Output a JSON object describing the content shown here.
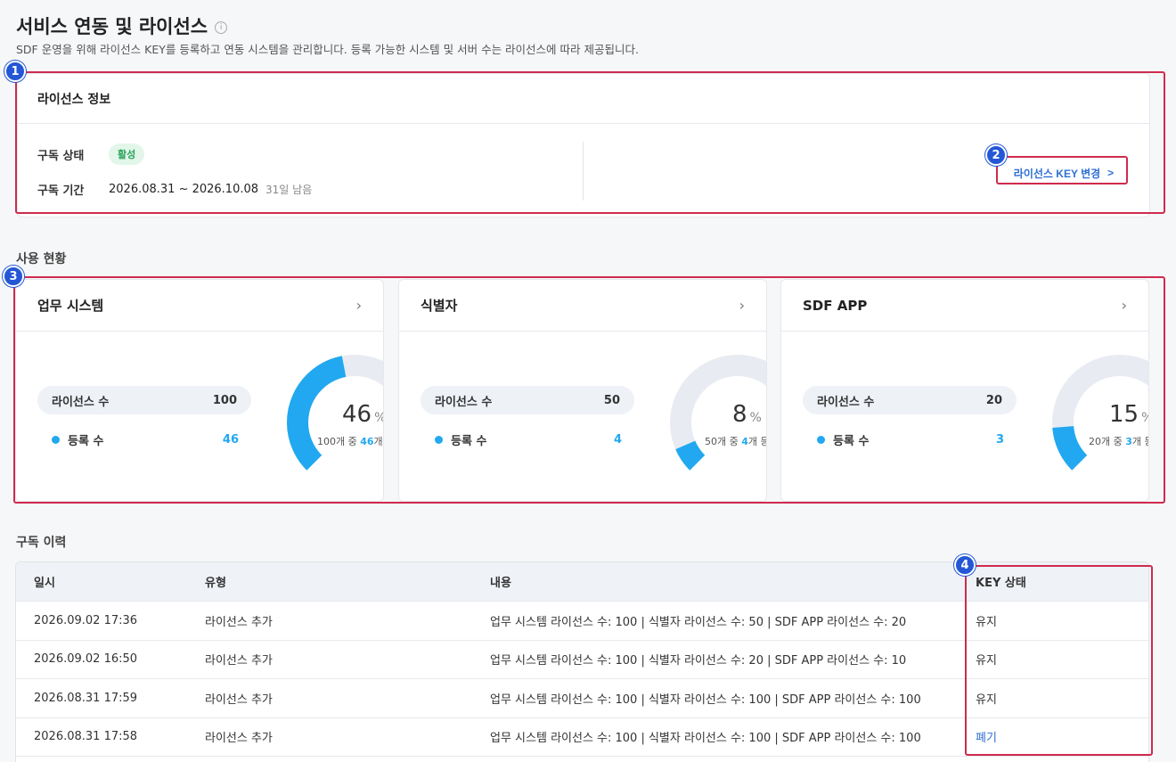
{
  "header": {
    "title": "서비스 연동 및 라이선스",
    "info_icon": "i",
    "description": "SDF 운영을 위해 라이선스 KEY를 등록하고 연동 시스템을 관리합니다. 등록 가능한 시스템 및 서버 수는 라이선스에 따라 제공됩니다."
  },
  "license": {
    "heading": "라이선스 정보",
    "status_label": "구독 상태",
    "status_value": "활성",
    "period_label": "구독 기간",
    "period_value": "2026.08.31 ~ 2026.10.08",
    "remaining": "31일 남음",
    "change_key_label": "라이선스 KEY 변경",
    "chevron": ">"
  },
  "usage": {
    "heading": "사용 현황",
    "license_count_label": "라이선스 수",
    "registered_label": "등록 수",
    "cards": [
      {
        "title": "업무 시스템",
        "total": "100",
        "registered": "46",
        "percent": "46",
        "pct_unit": "%",
        "sub_total": "100개 중 ",
        "sub_reg": "46",
        "sub_tail": "개 등록",
        "ratio": 0.46
      },
      {
        "title": "식별자",
        "total": "50",
        "registered": "4",
        "percent": "8",
        "pct_unit": "%",
        "sub_total": "50개 중 ",
        "sub_reg": "4",
        "sub_tail": "개 등록",
        "ratio": 0.08
      },
      {
        "title": "SDF APP",
        "total": "20",
        "registered": "3",
        "percent": "15",
        "pct_unit": "%",
        "sub_total": "20개 중 ",
        "sub_reg": "3",
        "sub_tail": "개 등록",
        "ratio": 0.15
      }
    ]
  },
  "history": {
    "heading": "구독 이력",
    "columns": [
      "일시",
      "유형",
      "내용",
      "KEY 상태"
    ],
    "rows": [
      {
        "date": "2026.09.02 17:36",
        "type": "라이선스 추가",
        "content": "업무 시스템 라이선스 수: 100 | 식별자 라이선스 수: 50 | SDF APP 라이선스 수: 20",
        "status": "유지"
      },
      {
        "date": "2026.09.02 16:50",
        "type": "라이선스 추가",
        "content": "업무 시스템 라이선스 수: 100 | 식별자 라이선스 수: 20 | SDF APP 라이선스 수: 10",
        "status": "유지"
      },
      {
        "date": "2026.08.31 17:59",
        "type": "라이선스 추가",
        "content": "업무 시스템 라이선스 수: 100 | 식별자 라이선스 수: 100 | SDF APP 라이선스 수: 100",
        "status": "유지"
      },
      {
        "date": "2026.08.31 17:58",
        "type": "라이선스 추가",
        "content": "업무 시스템 라이선스 수: 100 | 식별자 라이선스 수: 100 | SDF APP 라이선스 수: 100",
        "status": "폐기"
      }
    ]
  },
  "markers": [
    "1",
    "2",
    "3",
    "4"
  ],
  "colors": {
    "accent": "#21a8f0",
    "gauge_track": "#e8ecf2",
    "highlight": "#cf2b4e",
    "marker": "#2457d6",
    "link": "#2f6fd4"
  }
}
